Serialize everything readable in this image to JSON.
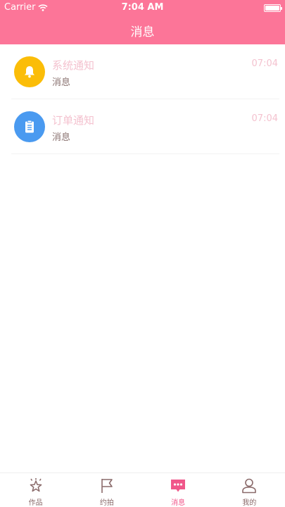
{
  "status_bar": {
    "carrier": "Carrier",
    "time": "7:04 AM"
  },
  "header": {
    "title": "消息"
  },
  "messages": [
    {
      "title": "系统通知",
      "subtitle": "消息",
      "time": "07:04",
      "icon": "bell-icon",
      "color": "#fbbd08"
    },
    {
      "title": "订单通知",
      "subtitle": "消息",
      "time": "07:04",
      "icon": "clipboard-icon",
      "color": "#4a9af0"
    }
  ],
  "tabs": [
    {
      "label": "作品",
      "icon": "star-icon",
      "active": false
    },
    {
      "label": "约拍",
      "icon": "flag-icon",
      "active": false
    },
    {
      "label": "消息",
      "icon": "chat-icon",
      "active": true
    },
    {
      "label": "我的",
      "icon": "person-icon",
      "active": false
    }
  ],
  "colors": {
    "brand": "#fc7598",
    "active_tab": "#f0578a",
    "muted_text": "#f4c2cf"
  }
}
